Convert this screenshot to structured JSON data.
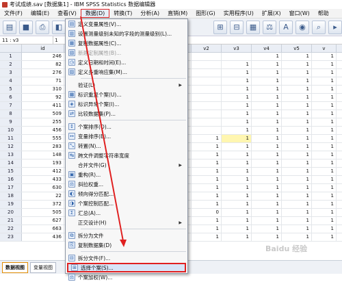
{
  "window": {
    "title": "考试成绩.sav [数据集1] - IBM SPSS Statistics 数据编辑器"
  },
  "menu": [
    "文件(F)",
    "编辑(E)",
    "查看(V)",
    "数据(D)",
    "转换(T)",
    "分析(A)",
    "直销(M)",
    "图形(G)",
    "实用程序(U)",
    "扩展(X)",
    "窗口(W)",
    "帮助"
  ],
  "cell_ref": {
    "cell": "11 : v3",
    "value": "1"
  },
  "columns": {
    "row_header": "",
    "id": "id",
    "v2": "v2",
    "v3": "v3",
    "v4": "v4",
    "v5": "v5",
    "v6": "v"
  },
  "rows": [
    {
      "n": "1",
      "id": "246",
      "v2": "",
      "v3": "",
      "v4": "1",
      "v5": "1",
      "v6": "1"
    },
    {
      "n": "2",
      "id": "82",
      "v2": "",
      "v3": "1",
      "v4": "1",
      "v5": "1",
      "v6": "1"
    },
    {
      "n": "3",
      "id": "276",
      "v2": "",
      "v3": "1",
      "v4": "1",
      "v5": "1",
      "v6": "1"
    },
    {
      "n": "4",
      "id": "71",
      "v2": "",
      "v3": "1",
      "v4": "1",
      "v5": "1",
      "v6": "1"
    },
    {
      "n": "5",
      "id": "310",
      "v2": "",
      "v3": "1",
      "v4": "1",
      "v5": "1",
      "v6": "1"
    },
    {
      "n": "6",
      "id": "92",
      "v2": "",
      "v3": "1",
      "v4": "1",
      "v5": "1",
      "v6": "1"
    },
    {
      "n": "7",
      "id": "411",
      "v2": "",
      "v3": "1",
      "v4": "1",
      "v5": "1",
      "v6": "1"
    },
    {
      "n": "8",
      "id": "509",
      "v2": "",
      "v3": "1",
      "v4": "1",
      "v5": "1",
      "v6": "1"
    },
    {
      "n": "9",
      "id": "255",
      "v2": "",
      "v3": "1",
      "v4": "1",
      "v5": "1",
      "v6": "1"
    },
    {
      "n": "10",
      "id": "456",
      "v2": "",
      "v3": "1",
      "v4": "1",
      "v5": "1",
      "v6": "1"
    },
    {
      "n": "11",
      "id": "555",
      "v2": "1",
      "v3": "1",
      "v4": "1",
      "v5": "1",
      "v6": "1"
    },
    {
      "n": "12",
      "id": "283",
      "v2": "1",
      "v3": "1",
      "v4": "1",
      "v5": "1",
      "v6": "1"
    },
    {
      "n": "13",
      "id": "148",
      "v2": "1",
      "v3": "1",
      "v4": "1",
      "v5": "1",
      "v6": "1"
    },
    {
      "n": "14",
      "id": "193",
      "v2": "1",
      "v3": "1",
      "v4": "1",
      "v5": "1",
      "v6": "1"
    },
    {
      "n": "15",
      "id": "412",
      "v2": "1",
      "v3": "1",
      "v4": "1",
      "v5": "1",
      "v6": "1"
    },
    {
      "n": "16",
      "id": "433",
      "v2": "1",
      "v3": "1",
      "v4": "1",
      "v5": "1",
      "v6": "1"
    },
    {
      "n": "17",
      "id": "630",
      "v2": "1",
      "v3": "1",
      "v4": "1",
      "v5": "1",
      "v6": "1"
    },
    {
      "n": "18",
      "id": "22",
      "v2": "1",
      "v3": "1",
      "v4": "1",
      "v5": "1",
      "v6": "1"
    },
    {
      "n": "19",
      "id": "372",
      "v2": "1",
      "v3": "1",
      "v4": "1",
      "v5": "1",
      "v6": "1"
    },
    {
      "n": "20",
      "id": "505",
      "v2": "0",
      "v3": "1",
      "v4": "1",
      "v5": "1",
      "v6": "1"
    },
    {
      "n": "21",
      "id": "627",
      "v2": "1",
      "v3": "1",
      "v4": "1",
      "v5": "1",
      "v6": "1"
    },
    {
      "n": "22",
      "id": "663",
      "v2": "1",
      "v3": "1",
      "v4": "1",
      "v5": "1",
      "v6": "1"
    },
    {
      "n": "23",
      "id": "436",
      "v2": "1",
      "v3": "1",
      "v4": "1",
      "v5": "1",
      "v6": "1"
    }
  ],
  "dropdown": [
    {
      "label": "定义变量属性(V)...",
      "icon": "define-properties-icon"
    },
    {
      "label": "设置测量级别未知的字段的测量级别(L)...",
      "icon": "measure-level-icon"
    },
    {
      "label": "复制数据属性(C)...",
      "icon": "copy-properties-icon"
    },
    {
      "label": "新建定制属性(B)...",
      "icon": "custom-attribute-icon",
      "disabled": true
    },
    {
      "label": "定义日期和时间(E)...",
      "icon": "date-time-icon"
    },
    {
      "label": "定义多重响应集(M)...",
      "icon": "multiple-response-icon"
    },
    {
      "sep": true
    },
    {
      "label": "验证(L)",
      "icon": "",
      "submenu": true
    },
    {
      "label": "标识重复个案(U)...",
      "icon": "duplicate-cases-icon"
    },
    {
      "label": "标识异常个案(I)...",
      "icon": "unusual-cases-icon"
    },
    {
      "label": "比较数据集(P)...",
      "icon": "compare-datasets-icon"
    },
    {
      "sep": true
    },
    {
      "label": "个案排序(O)...",
      "icon": "sort-cases-icon"
    },
    {
      "label": "变量排序(B)...",
      "icon": "sort-variables-icon"
    },
    {
      "label": "转置(N)...",
      "icon": "transpose-icon"
    },
    {
      "label": "跨文件调整字符串宽度",
      "icon": "string-width-icon"
    },
    {
      "label": "合并文件(G)",
      "icon": "",
      "submenu": true
    },
    {
      "label": "重构(R)...",
      "icon": "restructure-icon"
    },
    {
      "label": "斜拉权重...",
      "icon": "rake-weights-icon"
    },
    {
      "label": "倾向得分匹配...",
      "icon": "propensity-icon"
    },
    {
      "label": "个案控制匹配...",
      "icon": "case-control-icon"
    },
    {
      "label": "汇总(A)...",
      "icon": "aggregate-icon"
    },
    {
      "label": "正交设计(H)",
      "icon": "",
      "submenu": true
    },
    {
      "sep": true
    },
    {
      "label": "拆分为文件",
      "icon": "split-files-icon"
    },
    {
      "label": "复制数据集(D)",
      "icon": "copy-dataset-icon"
    },
    {
      "sep": true
    },
    {
      "label": "拆分文件(F)...",
      "icon": "split-file-icon"
    },
    {
      "label": "选择个案(S)...",
      "icon": "select-cases-icon",
      "selected": true
    },
    {
      "label": "个案加权(W)...",
      "icon": "weight-cases-icon"
    }
  ],
  "bottom_tabs": [
    "数据视图",
    "变量视图"
  ],
  "watermark": "Baidu 经验"
}
